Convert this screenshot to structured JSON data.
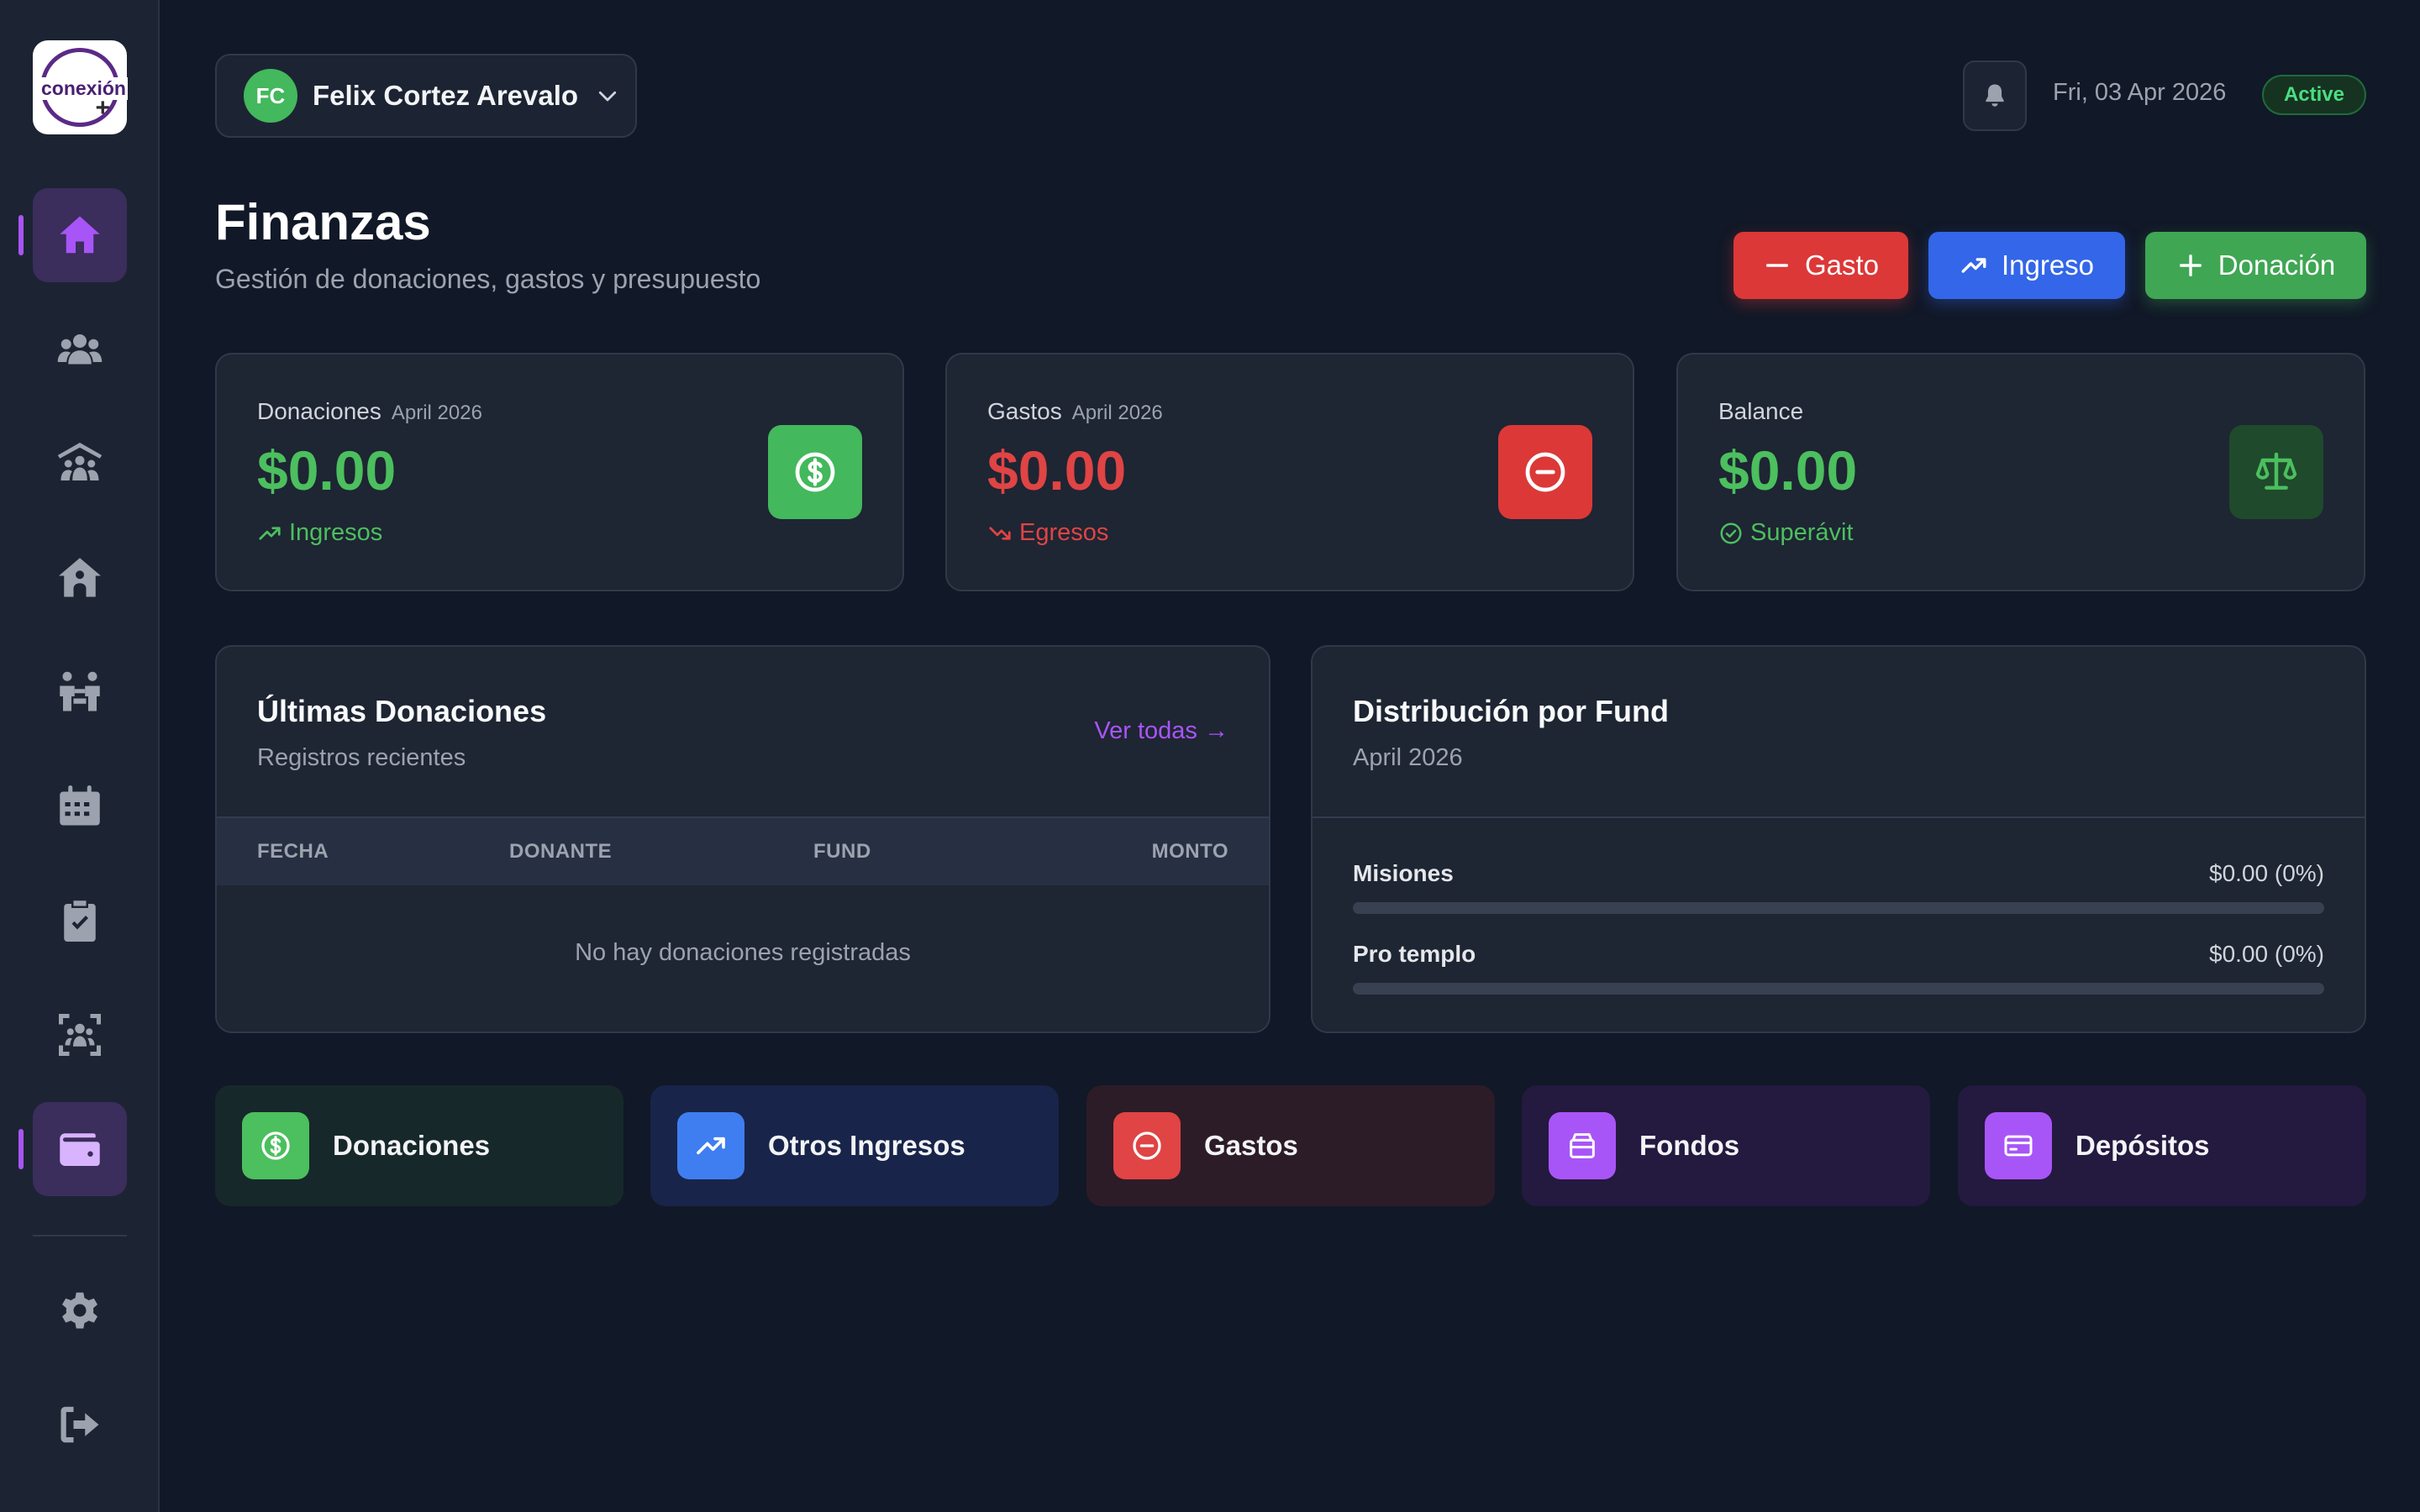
{
  "app": {
    "logo_text": "conexión",
    "logo_plus": "+"
  },
  "sidebar": {
    "items": [
      {
        "name": "home",
        "icon": "home-icon",
        "active": true
      },
      {
        "name": "members",
        "icon": "users-icon"
      },
      {
        "name": "ministries",
        "icon": "group-roof-icon"
      },
      {
        "name": "church",
        "icon": "church-icon"
      },
      {
        "name": "families",
        "icon": "family-icon"
      },
      {
        "name": "calendar",
        "icon": "calendar-icon"
      },
      {
        "name": "tasks",
        "icon": "clipboard-check-icon"
      },
      {
        "name": "attendance",
        "icon": "scan-users-icon"
      },
      {
        "name": "finance",
        "icon": "wallet-icon",
        "active": true
      },
      {
        "name": "settings",
        "icon": "gear-icon"
      },
      {
        "name": "logout",
        "icon": "logout-icon"
      }
    ]
  },
  "header": {
    "user_initials": "FC",
    "user_name": "Felix Cortez Arevalo",
    "date": "Fri, 03 Apr 2026",
    "status": "Active"
  },
  "page": {
    "title": "Finanzas",
    "subtitle": "Gestión de donaciones, gastos y presupuesto"
  },
  "actions": {
    "gasto": "Gasto",
    "ingreso": "Ingreso",
    "donacion": "Donación"
  },
  "stats": [
    {
      "label": "Donaciones",
      "period": "April 2026",
      "amount": "$0.00",
      "trend": "Ingresos",
      "color": "#4cbf5e"
    },
    {
      "label": "Gastos",
      "period": "April 2026",
      "amount": "$0.00",
      "trend": "Egresos",
      "color": "#e04444"
    },
    {
      "label": "Balance",
      "period": "",
      "amount": "$0.00",
      "trend": "Superávit",
      "color": "#4cbf5e"
    }
  ],
  "donations_panel": {
    "title": "Últimas Donaciones",
    "subtitle": "Registros recientes",
    "link": "Ver todas →",
    "columns": [
      "FECHA",
      "DONANTE",
      "FUND",
      "MONTO"
    ],
    "empty": "No hay donaciones registradas"
  },
  "distribution_panel": {
    "title": "Distribución por Fund",
    "subtitle": "April 2026",
    "funds": [
      {
        "name": "Misiones",
        "value": "$0.00 (0%)",
        "percent": 0
      },
      {
        "name": "Pro templo",
        "value": "$0.00 (0%)",
        "percent": 0
      }
    ]
  },
  "quick_links": [
    {
      "label": "Donaciones",
      "icon": "dollar-circle-icon",
      "accent": "#4cbf5e"
    },
    {
      "label": "Otros Ingresos",
      "icon": "trending-up-icon",
      "accent": "#3f7ef0"
    },
    {
      "label": "Gastos",
      "icon": "minus-circle-icon",
      "accent": "#e04444"
    },
    {
      "label": "Fondos",
      "icon": "archive-icon",
      "accent": "#a855f7"
    },
    {
      "label": "Depósitos",
      "icon": "credit-card-icon",
      "accent": "#a855f7"
    }
  ]
}
